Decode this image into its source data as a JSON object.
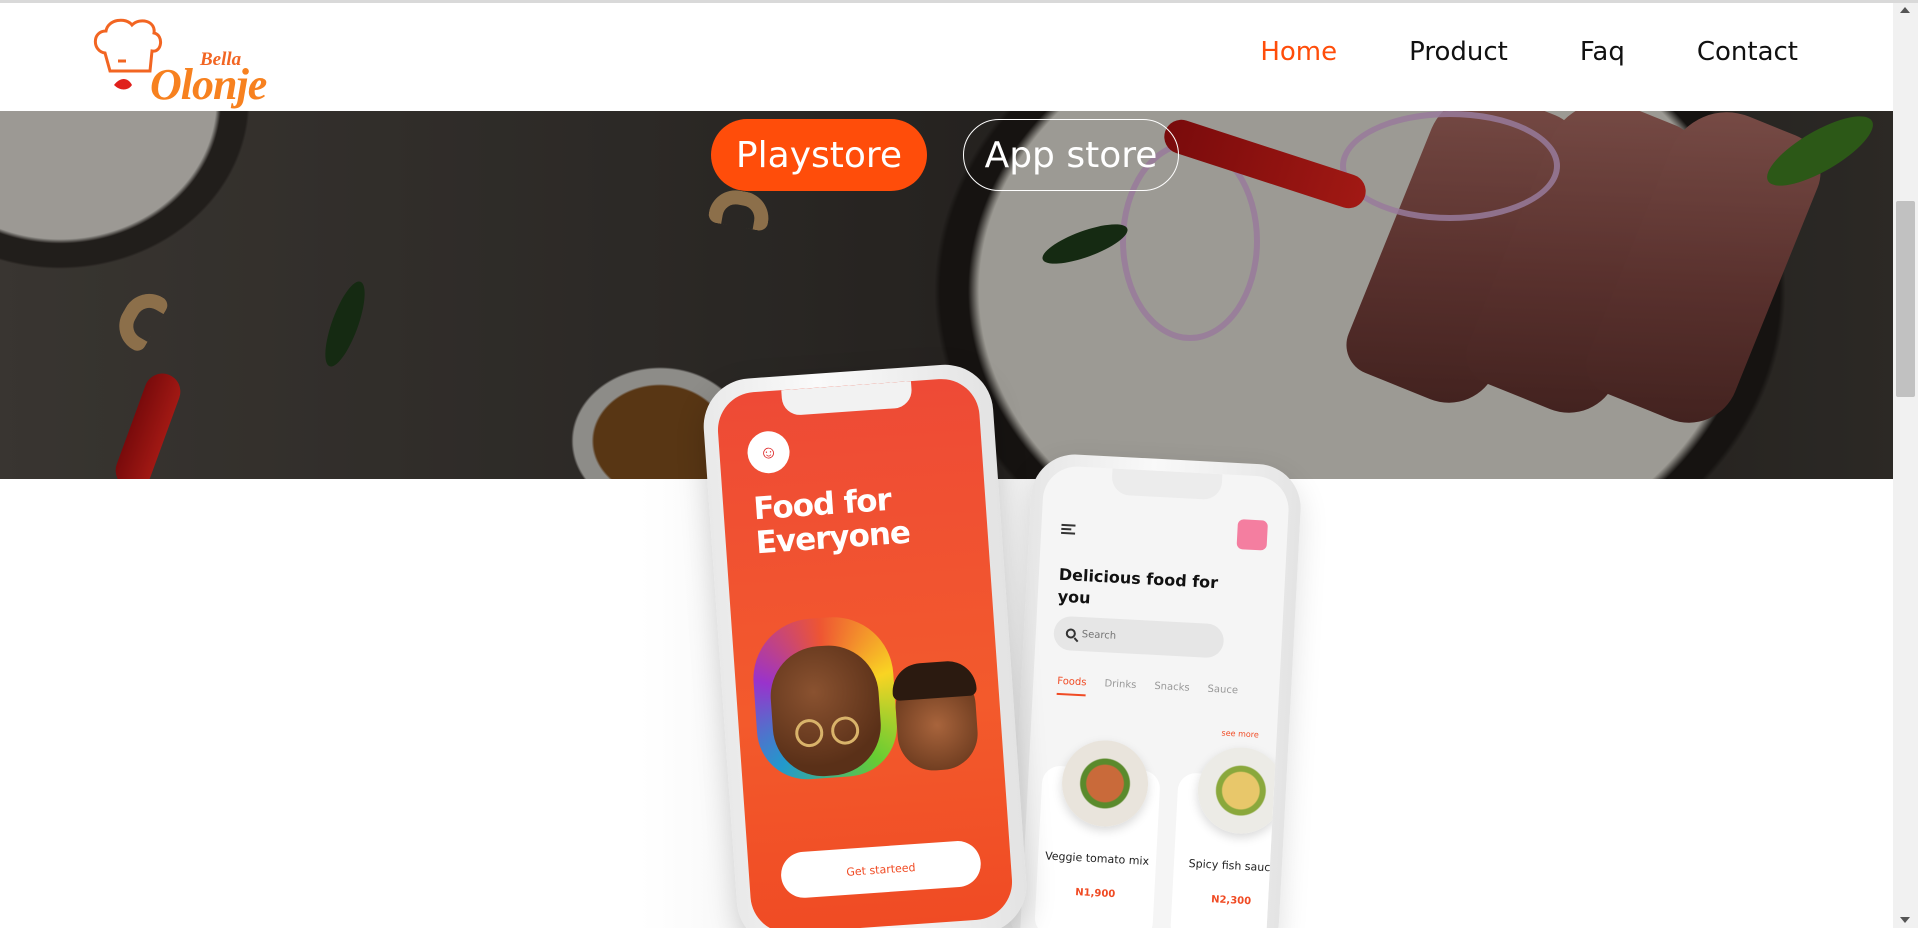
{
  "brand": {
    "logo_top": "Bella",
    "logo_main": "Olonje"
  },
  "nav": {
    "items": [
      {
        "label": "Home",
        "active": true
      },
      {
        "label": "Product",
        "active": false
      },
      {
        "label": "Faq",
        "active": false
      },
      {
        "label": "Contact",
        "active": false
      }
    ]
  },
  "hero": {
    "playstore_label": "Playstore",
    "appstore_label": "App store"
  },
  "phone1": {
    "headline": "Food for Everyone",
    "cta_label": "Get starteed"
  },
  "phone2": {
    "headline": "Delicious food for you",
    "search_placeholder": "Search",
    "tabs": [
      "Foods",
      "Drinks",
      "Snacks",
      "Sauce"
    ],
    "see_more": "see more",
    "cards": [
      {
        "name": "Veggie tomato mix",
        "price": "N1,900"
      },
      {
        "name": "Spicy fish sauce",
        "price": "N2,300"
      }
    ]
  },
  "colors": {
    "accent": "#ff4d0a",
    "text": "#111111",
    "phone_red": "#f04b24"
  }
}
